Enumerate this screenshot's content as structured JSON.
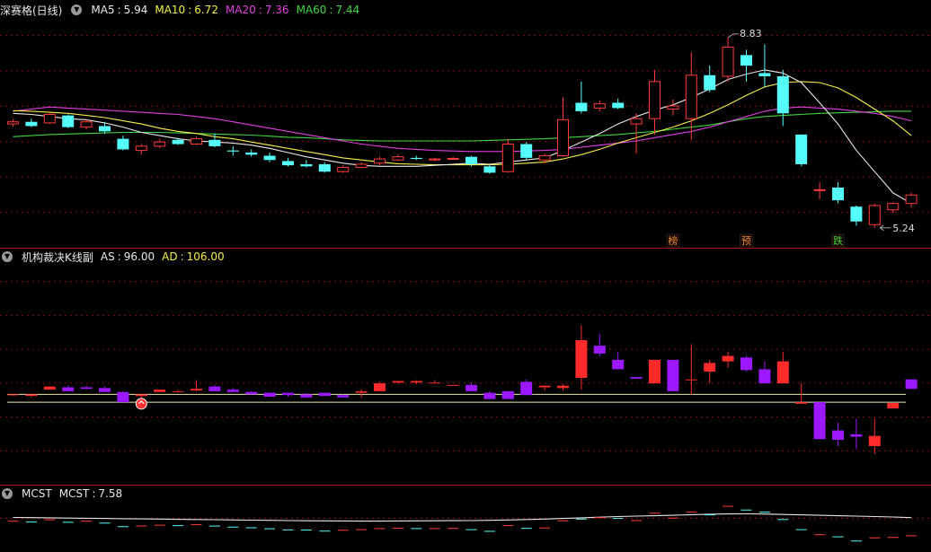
{
  "colors": {
    "up": "#ff3b3b",
    "down": "#54fcfc",
    "ind_up": "#ff2b2b",
    "ind_down": "#9b18ff",
    "ma5": "#e8e8e8",
    "ma10": "#f5f04a",
    "ma20": "#e040e0",
    "ma60": "#3fd53f",
    "grid": "#7a1010",
    "border": "#a01818",
    "sig1": "#e88a3a",
    "sig2": "#3fd53f",
    "level": "#e8e8b0",
    "mcst": "#e8e8e8"
  },
  "panel1": {
    "title": "深赛格(日线)",
    "legend": [
      {
        "name": "MA5",
        "value": "5.94"
      },
      {
        "name": "MA10",
        "value": "6.72"
      },
      {
        "name": "MA20",
        "value": "7.36"
      },
      {
        "name": "MA60",
        "value": "7.44"
      }
    ],
    "high_label": "8.83",
    "low_label": "5.24",
    "signals": [
      {
        "index": 36,
        "text": "榜",
        "kind": "a"
      },
      {
        "index": 40,
        "text": "预",
        "kind": "a"
      },
      {
        "index": 45,
        "text": "跌",
        "kind": "b"
      }
    ]
  },
  "panel2": {
    "title": "机构裁决K线副",
    "legend": [
      {
        "name": "AS",
        "value": "96.00"
      },
      {
        "name": "AD",
        "value": "106.00"
      }
    ]
  },
  "panel3": {
    "title": "MCST",
    "legend": [
      {
        "name": "MCST",
        "value": "7.58"
      }
    ]
  },
  "chart_data": [
    {
      "type": "candlestick",
      "title": "深赛格(日线)",
      "ylim": [
        5.0,
        9.2
      ],
      "candles": [
        [
          7.2,
          7.3,
          7.15,
          7.24
        ],
        [
          7.24,
          7.3,
          7.14,
          7.16
        ],
        [
          7.22,
          7.42,
          7.2,
          7.38
        ],
        [
          7.36,
          7.38,
          7.12,
          7.14
        ],
        [
          7.14,
          7.3,
          7.1,
          7.24
        ],
        [
          7.16,
          7.24,
          7.02,
          7.06
        ],
        [
          6.92,
          6.98,
          6.7,
          6.72
        ],
        [
          6.7,
          6.82,
          6.62,
          6.78
        ],
        [
          6.78,
          6.92,
          6.74,
          6.86
        ],
        [
          6.9,
          6.94,
          6.8,
          6.82
        ],
        [
          6.82,
          6.96,
          6.8,
          6.92
        ],
        [
          6.9,
          7.02,
          6.76,
          6.78
        ],
        [
          6.7,
          6.78,
          6.6,
          6.68
        ],
        [
          6.66,
          6.72,
          6.58,
          6.62
        ],
        [
          6.6,
          6.66,
          6.48,
          6.52
        ],
        [
          6.5,
          6.56,
          6.4,
          6.42
        ],
        [
          6.44,
          6.52,
          6.38,
          6.4
        ],
        [
          6.44,
          6.48,
          6.28,
          6.3
        ],
        [
          6.3,
          6.42,
          6.28,
          6.38
        ],
        [
          6.38,
          6.48,
          6.36,
          6.44
        ],
        [
          6.46,
          6.58,
          6.42,
          6.54
        ],
        [
          6.52,
          6.62,
          6.5,
          6.58
        ],
        [
          6.56,
          6.6,
          6.52,
          6.54
        ],
        [
          6.52,
          6.56,
          6.5,
          6.54
        ],
        [
          6.54,
          6.58,
          6.52,
          6.55
        ],
        [
          6.58,
          6.6,
          6.4,
          6.44
        ],
        [
          6.4,
          6.42,
          6.26,
          6.28
        ],
        [
          6.3,
          6.92,
          6.28,
          6.82
        ],
        [
          6.82,
          6.86,
          6.52,
          6.56
        ],
        [
          6.52,
          6.64,
          6.46,
          6.6
        ],
        [
          6.6,
          7.7,
          6.58,
          7.28
        ],
        [
          7.6,
          8.0,
          7.4,
          7.44
        ],
        [
          7.5,
          7.64,
          7.44,
          7.58
        ],
        [
          7.6,
          7.68,
          7.48,
          7.5
        ],
        [
          7.2,
          7.4,
          6.64,
          7.3
        ],
        [
          7.3,
          8.22,
          7.0,
          8.0
        ],
        [
          7.48,
          7.66,
          7.36,
          7.54
        ],
        [
          7.3,
          8.55,
          6.9,
          8.12
        ],
        [
          8.12,
          8.3,
          7.8,
          7.84
        ],
        [
          8.1,
          8.83,
          8.0,
          8.65
        ],
        [
          8.5,
          8.6,
          8.0,
          8.3
        ],
        [
          8.16,
          8.7,
          7.9,
          8.1
        ],
        [
          8.1,
          8.22,
          7.16,
          7.4
        ],
        [
          7.0,
          7.0,
          6.4,
          6.44
        ],
        [
          5.95,
          6.1,
          5.78,
          5.96
        ],
        [
          6.0,
          6.1,
          5.7,
          5.76
        ],
        [
          5.64,
          5.66,
          5.28,
          5.36
        ],
        [
          5.3,
          5.7,
          5.24,
          5.66
        ],
        [
          5.58,
          5.72,
          5.52,
          5.7
        ],
        [
          5.7,
          5.9,
          5.62,
          5.86
        ]
      ],
      "series": [
        {
          "name": "MA5",
          "values": [
            7.4,
            7.38,
            7.34,
            7.3,
            7.28,
            7.22,
            7.14,
            7.04,
            6.98,
            6.92,
            6.88,
            6.86,
            6.84,
            6.8,
            6.74,
            6.66,
            6.58,
            6.52,
            6.46,
            6.42,
            6.4,
            6.4,
            6.4,
            6.42,
            6.44,
            6.46,
            6.44,
            6.48,
            6.52,
            6.56,
            6.7,
            6.86,
            7.02,
            7.2,
            7.34,
            7.46,
            7.56,
            7.7,
            7.86,
            8.04,
            8.14,
            8.22,
            8.16,
            7.98,
            7.6,
            7.2,
            6.7,
            6.3,
            5.9,
            5.7
          ]
        },
        {
          "name": "MA10",
          "values": [
            7.45,
            7.44,
            7.42,
            7.4,
            7.36,
            7.32,
            7.26,
            7.2,
            7.12,
            7.06,
            7.02,
            6.96,
            6.92,
            6.86,
            6.8,
            6.74,
            6.68,
            6.62,
            6.56,
            6.52,
            6.48,
            6.45,
            6.44,
            6.43,
            6.43,
            6.43,
            6.43,
            6.44,
            6.46,
            6.48,
            6.54,
            6.62,
            6.72,
            6.84,
            6.94,
            7.04,
            7.14,
            7.26,
            7.4,
            7.56,
            7.74,
            7.9,
            7.98,
            8.0,
            7.98,
            7.88,
            7.7,
            7.48,
            7.26,
            6.98
          ]
        },
        {
          "name": "MA20",
          "values": [
            7.44,
            7.48,
            7.52,
            7.5,
            7.48,
            7.46,
            7.44,
            7.42,
            7.4,
            7.38,
            7.34,
            7.3,
            7.24,
            7.18,
            7.12,
            7.06,
            7.0,
            6.94,
            6.88,
            6.82,
            6.78,
            6.74,
            6.72,
            6.7,
            6.69,
            6.68,
            6.68,
            6.68,
            6.69,
            6.7,
            6.72,
            6.76,
            6.8,
            6.84,
            6.88,
            6.94,
            7.0,
            7.06,
            7.14,
            7.24,
            7.34,
            7.44,
            7.5,
            7.52,
            7.5,
            7.48,
            7.44,
            7.4,
            7.34,
            7.26
          ]
        },
        {
          "name": "MA60",
          "values": [
            6.96,
            6.98,
            7.0,
            7.01,
            7.02,
            7.03,
            7.04,
            7.04,
            7.04,
            7.03,
            7.02,
            7.01,
            7.0,
            6.99,
            6.97,
            6.95,
            6.94,
            6.92,
            6.9,
            6.89,
            6.88,
            6.88,
            6.88,
            6.88,
            6.88,
            6.88,
            6.89,
            6.9,
            6.91,
            6.92,
            6.94,
            6.96,
            6.98,
            7.0,
            7.03,
            7.06,
            7.1,
            7.14,
            7.18,
            7.24,
            7.3,
            7.34,
            7.36,
            7.38,
            7.4,
            7.41,
            7.42,
            7.43,
            7.44,
            7.44
          ]
        }
      ]
    },
    {
      "type": "candlestick",
      "title": "机构裁决K线副",
      "ylim": [
        0,
        270
      ],
      "levels": [
        96.0,
        106.0
      ],
      "candles": [
        [
          106,
          106,
          104,
          106
        ],
        [
          104,
          106,
          102,
          106
        ],
        [
          112,
          116,
          112,
          116
        ],
        [
          115,
          117,
          110,
          110
        ],
        [
          115,
          117,
          113,
          113
        ],
        [
          114,
          116,
          109,
          109
        ],
        [
          109,
          110,
          96,
          96
        ],
        [
          104,
          106,
          101,
          106
        ],
        [
          109,
          112,
          109,
          112
        ],
        [
          110,
          112,
          109,
          110
        ],
        [
          111,
          124,
          110,
          113
        ],
        [
          116,
          118,
          110,
          110
        ],
        [
          112,
          114,
          109,
          109
        ],
        [
          109,
          110,
          106,
          106
        ],
        [
          108,
          108,
          103,
          103
        ],
        [
          108,
          108,
          103,
          105
        ],
        [
          106,
          108,
          102,
          102
        ],
        [
          108,
          108,
          104,
          104
        ],
        [
          105,
          106,
          102,
          102
        ],
        [
          108,
          112,
          102,
          110
        ],
        [
          110,
          122,
          110,
          120
        ],
        [
          121,
          123,
          119,
          123
        ],
        [
          121,
          124,
          119,
          123
        ],
        [
          121,
          124,
          120,
          121
        ],
        [
          118,
          118,
          118,
          118
        ],
        [
          118,
          121,
          110,
          110
        ],
        [
          108,
          110,
          100,
          100
        ],
        [
          110,
          110,
          100,
          100
        ],
        [
          122,
          125,
          105,
          105
        ],
        [
          115,
          117,
          111,
          117
        ],
        [
          114,
          119,
          111,
          117
        ],
        [
          127,
          194,
          112,
          175
        ],
        [
          168,
          183,
          155,
          158
        ],
        [
          150,
          160,
          138,
          138
        ],
        [
          128,
          128,
          126,
          126
        ],
        [
          120,
          150,
          120,
          150
        ],
        [
          150,
          150,
          110,
          110
        ],
        [
          125,
          170,
          105,
          125
        ],
        [
          135,
          150,
          120,
          146
        ],
        [
          148,
          160,
          140,
          155
        ],
        [
          153,
          155,
          135,
          137
        ],
        [
          138,
          148,
          120,
          120
        ],
        [
          120,
          160,
          125,
          148
        ],
        [
          94,
          120,
          96,
          96
        ],
        [
          96,
          90,
          49,
          49
        ],
        [
          60,
          70,
          40,
          48
        ],
        [
          55,
          75,
          36,
          52
        ],
        [
          40,
          75,
          30,
          53
        ],
        [
          88,
          89,
          95,
          95
        ],
        [
          125,
          113,
          125,
          113
        ]
      ]
    },
    {
      "type": "line",
      "title": "MCST",
      "ylim": [
        5.0,
        9.0
      ],
      "series": [
        {
          "name": "MCST",
          "values": [
            7.6,
            7.58,
            7.56,
            7.54,
            7.52,
            7.5,
            7.48,
            7.46,
            7.44,
            7.42,
            7.4,
            7.38,
            7.36,
            7.34,
            7.32,
            7.3,
            7.28,
            7.27,
            7.26,
            7.25,
            7.25,
            7.26,
            7.27,
            7.28,
            7.29,
            7.3,
            7.32,
            7.36,
            7.4,
            7.44,
            7.5,
            7.56,
            7.62,
            7.68,
            7.72,
            7.76,
            7.8,
            7.86,
            7.9,
            7.93,
            7.94,
            7.92,
            7.88,
            7.84,
            7.8,
            7.76,
            7.72,
            7.68,
            7.64,
            7.58
          ]
        }
      ]
    }
  ]
}
